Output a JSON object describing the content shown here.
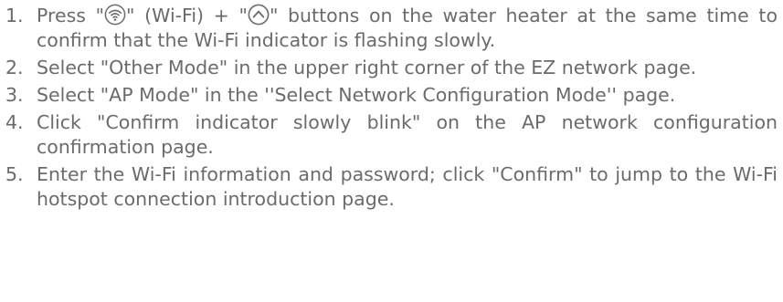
{
  "icons": {
    "wifi": "wifi-icon",
    "up": "chevron-up-circle-icon"
  },
  "colors": {
    "text": "#6b6b6b"
  },
  "steps": [
    {
      "num": "1.",
      "parts": {
        "a": "Press \"",
        "b": "\" (Wi-Fi) + \"",
        "c": "\" buttons on the water heater at the same time to confirm that the Wi-Fi indicator is flashing slowly."
      }
    },
    {
      "num": "2.",
      "text": "Select \"Other Mode\" in the upper right corner of the EZ network page."
    },
    {
      "num": "3.",
      "text": "Select \"AP Mode\" in the ''Select Network Configuration Mode'' page."
    },
    {
      "num": "4.",
      "text": "Click \"Confirm indicator slowly blink\" on the AP network configuration confirmation page."
    },
    {
      "num": "5.",
      "text": "Enter the Wi-Fi information and password; click \"Confirm\" to jump to the Wi-Fi hotspot connection introduction page."
    }
  ]
}
